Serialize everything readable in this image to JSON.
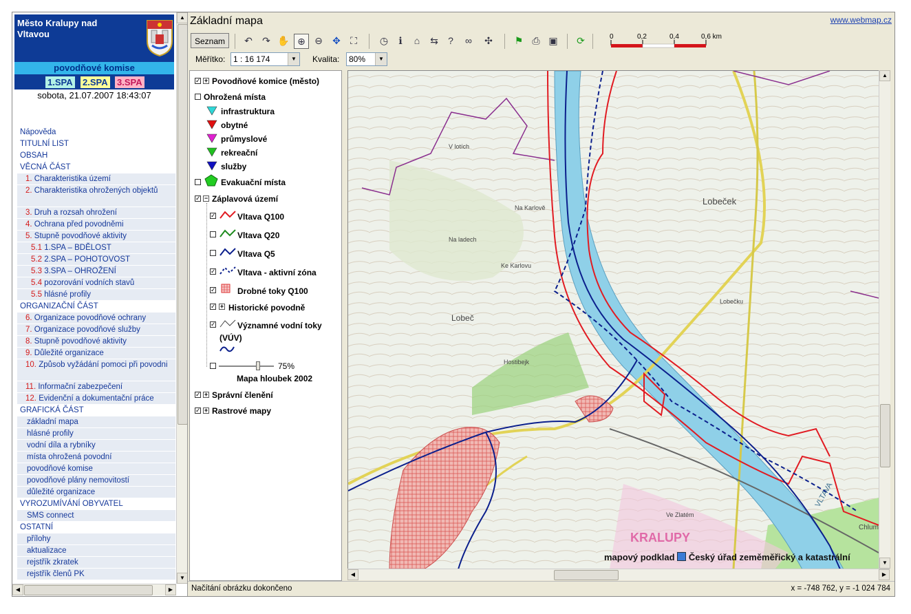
{
  "colors": {
    "header_blue": "#0e3b96",
    "commission_cyan": "#33b5ea",
    "spa1": "#b3f2e6",
    "spa2": "#ffff99",
    "spa3": "#ffb3c6",
    "nav_link": "#15389a",
    "nav_number": "#d41a1a",
    "q100_red": "#e11b22",
    "q20_green": "#1e8b1e",
    "q5_blue": "#0b1f8c",
    "river": "#8fd0e8"
  },
  "left": {
    "town_title": "Město Kralupy nad Vltavou",
    "crest_icon": "town-crest-icon",
    "commission": "povodňové komise",
    "spa": [
      "1.SPA",
      "2.SPA",
      "3.SPA"
    ],
    "datetime": "sobota, 21.07.2007 18:43:07",
    "nav": [
      {
        "kind": "sec",
        "label": "Nápověda"
      },
      {
        "kind": "sec",
        "label": "TITULNÍ LIST"
      },
      {
        "kind": "sec",
        "label": "OBSAH"
      },
      {
        "kind": "sec",
        "label": "VĚCNÁ ČÁST"
      },
      {
        "kind": "it",
        "num": "1.",
        "label": "Charakteristika území"
      },
      {
        "kind": "it2",
        "num": "2.",
        "label": "Charakteristika ohrožených objektů"
      },
      {
        "kind": "it",
        "num": "3.",
        "label": "Druh a rozsah ohrožení"
      },
      {
        "kind": "it",
        "num": "4.",
        "label": "Ochrana před povodněmi"
      },
      {
        "kind": "it",
        "num": "5.",
        "label": "Stupně povodňové aktivity"
      },
      {
        "kind": "sub",
        "num": "5.1",
        "label": "1.SPA – BDĚLOST"
      },
      {
        "kind": "sub",
        "num": "5.2",
        "label": "2.SPA – POHOTOVOST"
      },
      {
        "kind": "sub",
        "num": "5.3",
        "label": "3.SPA – OHROŽENÍ"
      },
      {
        "kind": "sub",
        "num": "5.4",
        "label": "pozorování vodních stavů"
      },
      {
        "kind": "sub",
        "num": "5.5",
        "label": "hlásné profily"
      },
      {
        "kind": "sec",
        "label": "ORGANIZAČNÍ ČÁST"
      },
      {
        "kind": "it",
        "num": "6.",
        "label": "Organizace povodňové ochrany"
      },
      {
        "kind": "it",
        "num": "7.",
        "label": "Organizace povodňové služby"
      },
      {
        "kind": "it",
        "num": "8.",
        "label": "Stupně povodňové aktivity"
      },
      {
        "kind": "it",
        "num": "9.",
        "label": "Důležité organizace"
      },
      {
        "kind": "it2",
        "num": "10.",
        "label": "Způsob vyžádání pomoci při povodni"
      },
      {
        "kind": "it",
        "num": "11.",
        "label": "Informační zabezpečení"
      },
      {
        "kind": "it",
        "num": "12.",
        "label": "Evidenční a dokumentační práce"
      },
      {
        "kind": "sec",
        "label": "GRAFICKÁ ČÁST"
      },
      {
        "kind": "itp",
        "label": "základní mapa"
      },
      {
        "kind": "itp",
        "label": "hlásné profily"
      },
      {
        "kind": "itp",
        "label": "vodní díla a rybníky"
      },
      {
        "kind": "itp",
        "label": "místa ohrožená povodní"
      },
      {
        "kind": "itp",
        "label": "povodňové komise"
      },
      {
        "kind": "itp",
        "label": "povodňové plány nemovitostí"
      },
      {
        "kind": "itp",
        "label": "důležité organizace"
      },
      {
        "kind": "sec",
        "label": "VYROZUMÍVÁNÍ OBYVATEL"
      },
      {
        "kind": "itp",
        "label": "SMS connect"
      },
      {
        "kind": "sec",
        "label": "OSTATNÍ"
      },
      {
        "kind": "itp",
        "label": "přílohy"
      },
      {
        "kind": "itp",
        "label": "aktualizace"
      },
      {
        "kind": "itp",
        "label": "rejstřík zkratek"
      },
      {
        "kind": "itp",
        "label": "rejstřík členů PK"
      }
    ]
  },
  "header": {
    "title": "Základní mapa",
    "web_link": "www.webmap.cz"
  },
  "toolbar": {
    "list_button": "Seznam",
    "tools": [
      "zoom-to-previous-icon",
      "zoom-to-next-icon",
      "pan-hand-icon",
      "zoom-in-icon",
      "zoom-out-icon",
      "move-arrows-icon",
      "full-extent-icon",
      "measure-icon",
      "info-icon",
      "home-icon",
      "layer-switch-icon",
      "help-icon",
      "binoculars-find-icon",
      "drag-arrows-icon",
      "flag-icon",
      "print-icon",
      "save-icon",
      "refresh-icon"
    ],
    "scale_ticks": [
      "0",
      "0,2",
      "0,4",
      "0,6 km"
    ]
  },
  "options": {
    "scale_label": "Měřítko:",
    "scale_value": "1 : 16 174",
    "quality_label": "Kvalita:",
    "quality_value": "80%"
  },
  "legend": {
    "groups": [
      {
        "label": "Povodňové komice (město)"
      },
      {
        "label": "Ohrožená místa"
      }
    ],
    "threat_items": [
      {
        "label": "infrastruktura",
        "color": "#2fd7d7"
      },
      {
        "label": "obytné",
        "color": "#e01010"
      },
      {
        "label": "průmyslové",
        "color": "#e020d0"
      },
      {
        "label": "rekreační",
        "color": "#20c020"
      },
      {
        "label": "služby",
        "color": "#1010c0"
      }
    ],
    "evac": "Evakuační místa",
    "flood_group": "Záplavová území",
    "flood_items": [
      "Vltava Q100",
      "Vltava Q20",
      "Vltava Q5",
      "Vltava - aktivní zóna",
      "Drobné toky Q100",
      "Historické povodně"
    ],
    "rivers_line1": "Významné vodní toky",
    "rivers_line2": "(VÚV)",
    "depth_pct": "75%",
    "depth_label": "Mapa hloubek 2002",
    "admin": "Správní členění",
    "raster": "Rastrové mapy"
  },
  "map": {
    "place_labels": [
      "Lobeček",
      "Lobeč",
      "Na ladech",
      "Na Karlově",
      "Hostibejk",
      "Ke Karlovu",
      "V lotích",
      "Lobečku",
      "VLTAVA",
      "KRALUPY",
      "Ve Zlatém",
      "Chlumecká"
    ],
    "attribution": "mapový podklad",
    "attribution_org": "Český úřad zeměměřický a katastrální"
  },
  "status": {
    "left": "Načítání obrázku dokončeno",
    "right": "x = -748 762, y = -1 024 784"
  }
}
